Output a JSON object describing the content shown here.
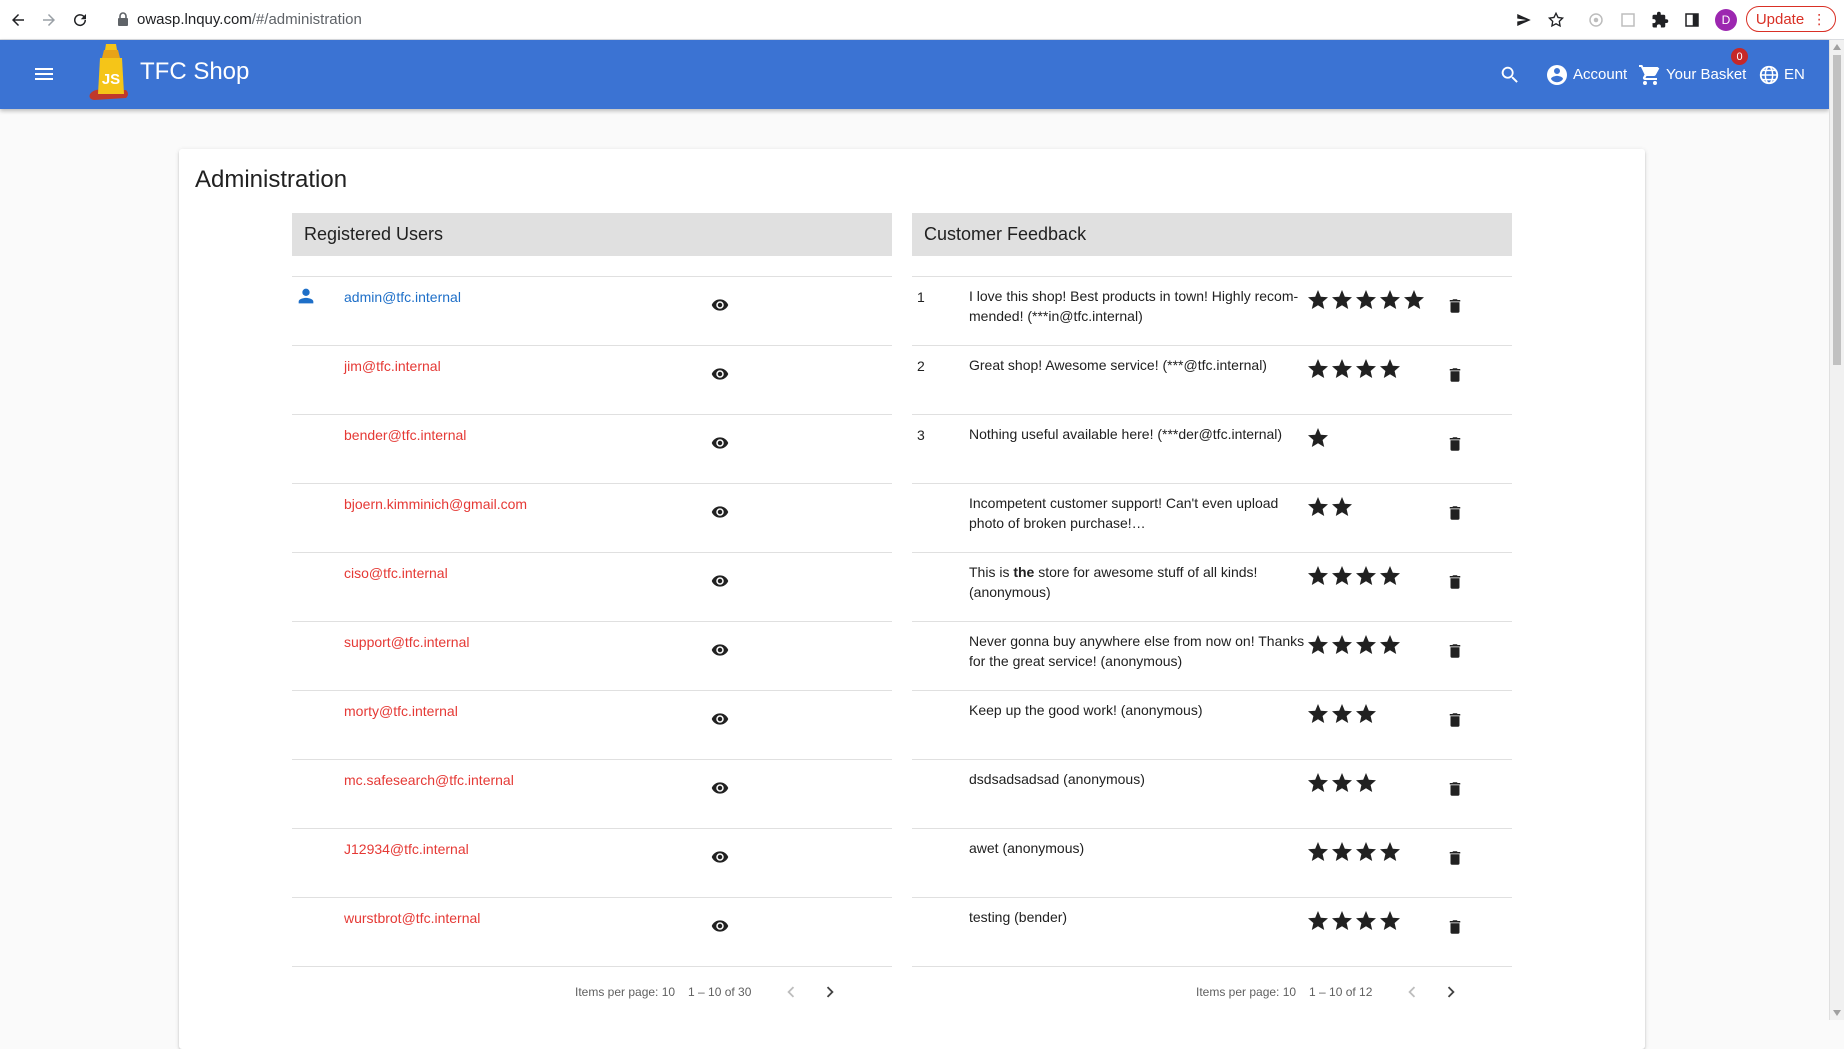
{
  "browser": {
    "url_host": "owasp.lnquy.com",
    "url_path": "/#/administration",
    "profile_initial": "D",
    "update_label": "Update"
  },
  "toolbar": {
    "title": "TFC Shop",
    "account_label": "Account",
    "basket_label": "Your Basket",
    "basket_count": "0",
    "language_label": "EN"
  },
  "page": {
    "title": "Administration"
  },
  "users": {
    "header": "Registered Users",
    "items": [
      {
        "email": "admin@tfc.internal"
      },
      {
        "email": "jim@tfc.internal"
      },
      {
        "email": "bender@tfc.internal"
      },
      {
        "email": "bjoern.kimminich@gmail.com"
      },
      {
        "email": "ciso@tfc.internal"
      },
      {
        "email": "support@tfc.internal"
      },
      {
        "email": "morty@tfc.internal"
      },
      {
        "email": "mc.safesearch@tfc.internal"
      },
      {
        "email": "J12934@tfc.internal"
      },
      {
        "email": "wurstbrot@tfc.internal"
      }
    ],
    "paginator": {
      "items_per_page": "Items per page: 10",
      "range": "1 – 10 of 30"
    }
  },
  "feedback": {
    "header": "Customer Feedback",
    "items": [
      {
        "num": "1",
        "comment": "I love this shop! Best products in town! Highly recom-mended! (***in@tfc.internal)",
        "rating": 5
      },
      {
        "num": "2",
        "comment": "Great shop! Awesome service! (***@tfc.internal)",
        "rating": 4
      },
      {
        "num": "3",
        "comment": "Nothing useful available here! (***der@tfc.internal)",
        "rating": 1
      },
      {
        "num": "",
        "comment": "Incompetent customer support! Can't even upload photo of broken purchase!…",
        "rating": 2
      },
      {
        "num": "",
        "comment_pre": "This is ",
        "comment_bold": "the",
        "comment_post": " store for awesome stuff of all kinds! (anonymous)",
        "rating": 4
      },
      {
        "num": "",
        "comment": "Never gonna buy anywhere else from now on! Thanks for the great service! (anonymous)",
        "rating": 4
      },
      {
        "num": "",
        "comment": "Keep up the good work! (anonymous)",
        "rating": 3
      },
      {
        "num": "",
        "comment": "dsdsadsadsad (anonymous)",
        "rating": 3
      },
      {
        "num": "",
        "comment": "awet (anonymous)",
        "rating": 4
      },
      {
        "num": "",
        "comment": "testing (bender)",
        "rating": 4
      }
    ],
    "paginator": {
      "items_per_page": "Items per page: 10",
      "range": "1 – 10 of 12"
    }
  },
  "colors": {
    "toolbar": "#3b73d3",
    "user_link": "#e53935",
    "admin_link": "#1e6fc8"
  }
}
